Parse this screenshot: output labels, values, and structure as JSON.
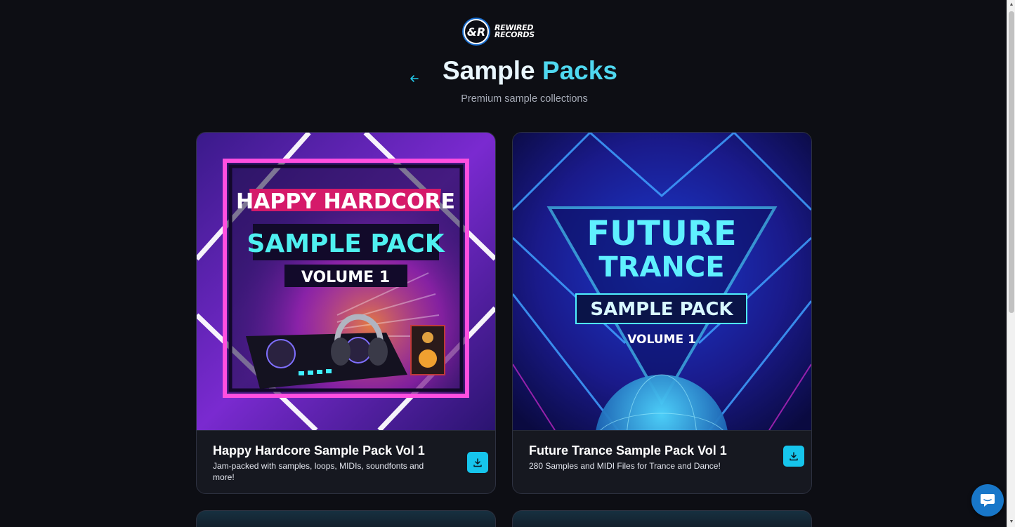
{
  "header": {
    "logo_line1": "REWIRED",
    "logo_line2": "RECORDS",
    "title_word1": "Sample",
    "title_word2": "Packs",
    "subtitle": "Premium sample collections"
  },
  "colors": {
    "background": "#0d0e14",
    "accent": "#16c5ec",
    "title_highlight": "#4fd8f0",
    "card_bg": "#161820"
  },
  "packs": [
    {
      "title": "Happy Hardcore Sample Pack Vol 1",
      "description": "Jam-packed with samples, loops, MIDIs, soundfonts and more!",
      "art": {
        "line1": "HAPPY HARDCORE",
        "line2": "SAMPLE PACK",
        "line3": "VOLUME 1"
      },
      "download_icon": "download-icon"
    },
    {
      "title": "Future Trance Sample Pack Vol 1",
      "description": "280 Samples and MIDI Files for Trance and Dance!",
      "art": {
        "line1": "FUTURE",
        "line2": "TRANCE",
        "line3": "SAMPLE PACK",
        "line4": "VOLUME 1"
      },
      "download_icon": "download-icon"
    }
  ],
  "icons": {
    "back": "arrow-left-icon",
    "chat": "chat-bubble-icon"
  }
}
